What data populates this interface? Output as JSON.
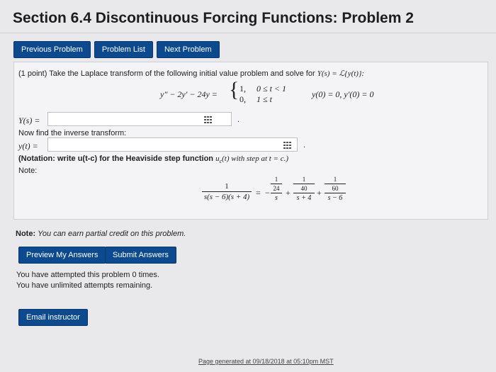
{
  "page": {
    "title": "Section 6.4 Discontinuous Forcing Functions: Problem 2"
  },
  "nav": {
    "previous": "Previous Problem",
    "list": "Problem List",
    "next": "Next Problem"
  },
  "problem": {
    "points": "(1 point)",
    "intro": "Take the Laplace transform of the following initial value problem and solve for",
    "intro_tail": "Y(s) = ℒ{y(t)}:",
    "ode_lhs": "y″ − 2y′ − 24y =",
    "piece1_value": "1,",
    "piece1_cond": "0 ≤ t < 1",
    "piece2_value": "0,",
    "piece2_cond": "1 ≤ t",
    "initial_conditions": "y(0) = 0,  y′(0) = 0",
    "ys_label": "Y(s) =",
    "inverse_prompt": "Now find the inverse transform:",
    "yt_label": "y(t) =",
    "notation_bold": "(Notation: write u(t-c) for the Heaviside step function",
    "notation_math": "u",
    "notation_sub": "c",
    "notation_math2": "(t) with step at t = c.)",
    "note_label": "Note:",
    "pf": {
      "num": "1",
      "den": "s(s − 6)(s + 4)",
      "eq": "=",
      "t1_sign": "−",
      "t1_num": "1",
      "t1_num_den": "24",
      "t1_den": "s",
      "plus1": "+",
      "t2_num": "1",
      "t2_num_den": "40",
      "t2_den": "s + 4",
      "plus2": "+",
      "t3_num": "1",
      "t3_num_den": "60",
      "t3_den": "s − 6"
    },
    "dot": "."
  },
  "credit_note": {
    "label": "Note:",
    "text": "You can earn partial credit on this problem."
  },
  "actions": {
    "preview": "Preview My Answers",
    "submit": "Submit Answers"
  },
  "status": {
    "attempted": "You have attempted this problem 0 times.",
    "remaining": "You have unlimited attempts remaining."
  },
  "email": "Email instructor",
  "footer": "Page generated at 09/18/2018 at 05:10pm MST",
  "colors": {
    "button": "#0c4a8f",
    "background": "#e9e9ec",
    "panel": "#f4f4f6"
  }
}
